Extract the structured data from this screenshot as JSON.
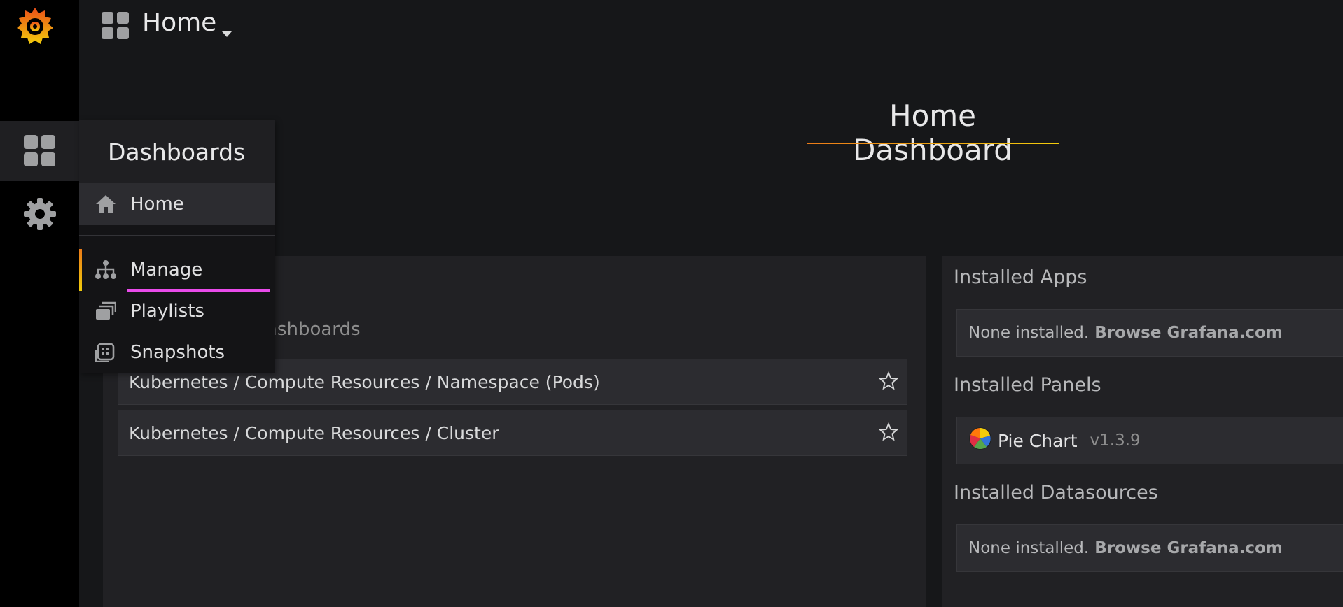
{
  "topbar": {
    "title": "Home"
  },
  "home": {
    "title": "Home Dashboard"
  },
  "left_panel": {
    "heading_1_partial": "s",
    "heading_2_partial": "ashboards",
    "dashboards": [
      "Kubernetes / Compute Resources / Namespace (Pods)",
      "Kubernetes / Compute Resources / Cluster"
    ]
  },
  "right_panel": {
    "apps": {
      "title": "Installed Apps",
      "none_text": "None installed.",
      "link": "Browse Grafana.com"
    },
    "panels": {
      "title": "Installed Panels",
      "plugin_name": "Pie Chart",
      "plugin_version": "v1.3.9"
    },
    "datasources": {
      "title": "Installed Datasources",
      "none_text": "None installed.",
      "link": "Browse Grafana.com"
    }
  },
  "menu": {
    "header": "Dashboards",
    "items": [
      {
        "label": "Home",
        "icon": "home-icon"
      },
      {
        "label": "Manage",
        "icon": "sitemap-icon"
      },
      {
        "label": "Playlists",
        "icon": "playlists-icon"
      },
      {
        "label": "Snapshots",
        "icon": "snapshots-icon"
      }
    ]
  },
  "colors": {
    "accent_orange": "#eb7b18",
    "accent_yellow": "#f2cc0c",
    "focus_pink": "#e94bea"
  }
}
